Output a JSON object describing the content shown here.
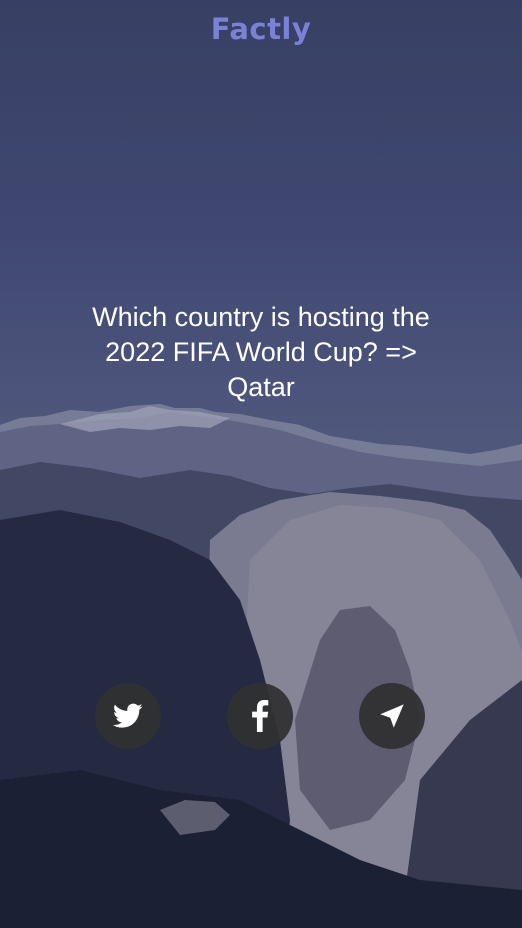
{
  "app": {
    "title": "Factly",
    "title_color": "#7b82d6"
  },
  "fact": {
    "text": "Which country is hosting the\n2022 FIFA World Cup?  =>\nQatar"
  },
  "background": {
    "description_icon": "mountain-landscape-image",
    "sky_color": "#4a5279",
    "shadow_color": "#1a1d30"
  },
  "share": {
    "buttons": [
      {
        "id": "twitter",
        "icon": "twitter-icon"
      },
      {
        "id": "facebook",
        "icon": "facebook-icon"
      },
      {
        "id": "send",
        "icon": "navigation-arrow-icon"
      }
    ],
    "button_color": "#303032",
    "icon_color": "#ffffff"
  }
}
